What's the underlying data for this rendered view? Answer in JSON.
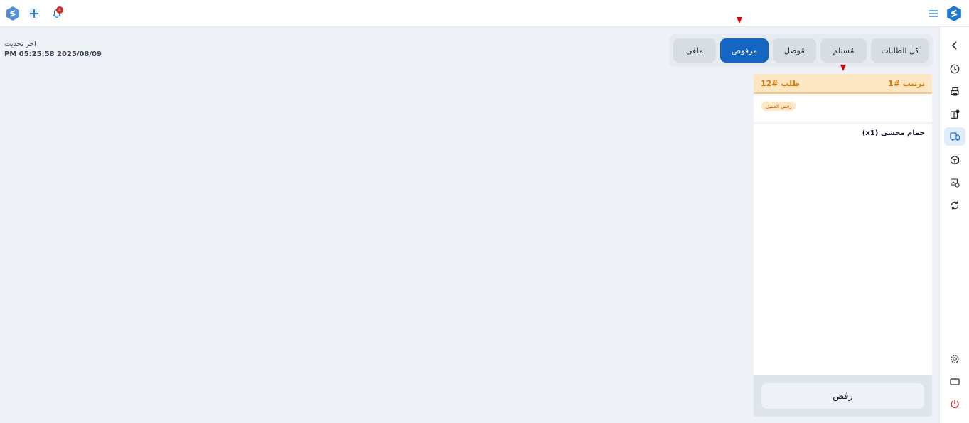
{
  "topbar": {
    "left_logo_icon": "app-logo-icon",
    "add_icon": "plus-circle-icon",
    "notification_icon": "bell-icon",
    "notification_count": "4",
    "menu_icon": "hamburger-menu-icon",
    "right_logo_icon": "app-logo-icon"
  },
  "sidebar": {
    "items": [
      {
        "icon": "chevron-left-icon"
      },
      {
        "icon": "clock-icon"
      },
      {
        "icon": "printer-icon"
      },
      {
        "icon": "orders-badge-icon"
      },
      {
        "icon": "delivery-icon",
        "active": true
      },
      {
        "icon": "box-icon"
      },
      {
        "icon": "image-settings-icon"
      },
      {
        "icon": "sync-icon"
      }
    ],
    "bottom_items": [
      {
        "icon": "gear-icon"
      },
      {
        "icon": "screen-icon"
      },
      {
        "icon": "power-icon"
      }
    ]
  },
  "last_update": {
    "label": "اخر تحديث",
    "value": "PM 05:25:58 2025/08/09"
  },
  "tabs": [
    {
      "label": "كل الطلبات"
    },
    {
      "label": "مُستلم"
    },
    {
      "label": "مُوصل"
    },
    {
      "label": "مرفوض",
      "active": true
    },
    {
      "label": "ملغي"
    }
  ],
  "order_card": {
    "rank": "ترتيب #1",
    "order_number": "طلب #12",
    "status_badge": "رفض العميل",
    "item_line": "حمام محشى (x1)",
    "reject_button": "رفض"
  },
  "colors": {
    "accent": "#1366c2",
    "warning_header": "#fde6c2",
    "warning_text": "#d97706",
    "badge_red": "#dc2626"
  }
}
